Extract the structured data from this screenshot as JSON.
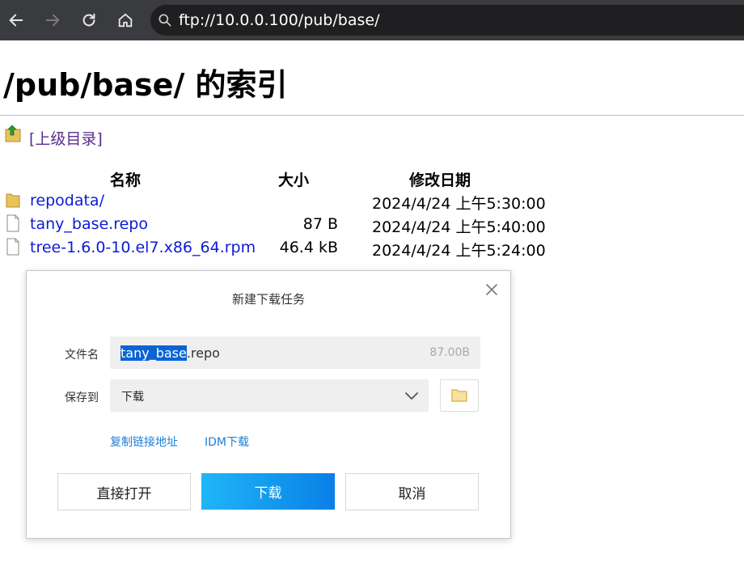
{
  "browser": {
    "url": "ftp://10.0.0.100/pub/base/",
    "icons": [
      "back-icon",
      "forward-icon",
      "reload-icon",
      "home-icon",
      "search-icon"
    ]
  },
  "page": {
    "title": "/pub/base/ 的索引",
    "parent_link": "[上级目录]",
    "columns": {
      "name": "名称",
      "size": "大小",
      "date": "修改日期"
    },
    "files": [
      {
        "name": "repodata/",
        "size": "",
        "date": "2024/4/24 上午5:30:00",
        "icon": "folder-icon"
      },
      {
        "name": "tany_base.repo",
        "size": "87 B",
        "date": "2024/4/24 上午5:40:00",
        "icon": "file-icon"
      },
      {
        "name": "tree-1.6.0-10.el7.x86_64.rpm",
        "size": "46.4 kB",
        "date": "2024/4/24 上午5:24:00",
        "icon": "file-icon"
      }
    ]
  },
  "dialog": {
    "title": "新建下载任务",
    "filename_label": "文件名",
    "filename_selected": "tany_base",
    "filename_rest": ".repo",
    "filesize": "87.00B",
    "saveto_label": "保存到",
    "saveto_value": "下载",
    "copy_link": "复制链接地址",
    "idm_link": "IDM下载",
    "open_button": "直接打开",
    "download_button": "下载",
    "cancel_button": "取消"
  },
  "colors": {
    "toolbar": "#3a3b3e",
    "link": "#0b1bd6",
    "visited_link": "#5a2b8c",
    "primary_button": "#0a7fe6",
    "dialog_link": "#1a7fd6"
  }
}
